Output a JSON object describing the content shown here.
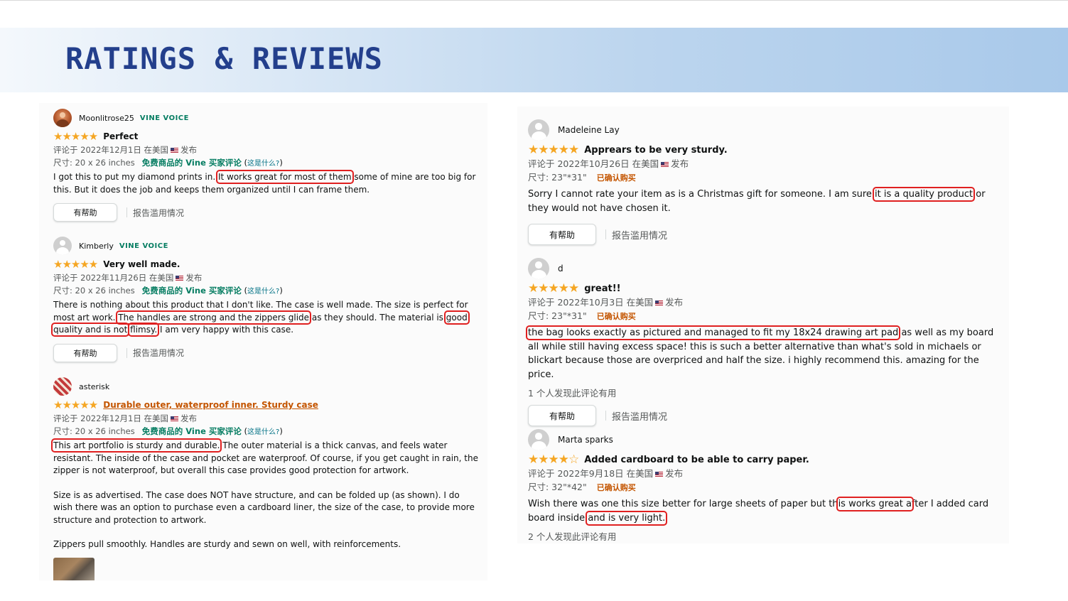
{
  "header": {
    "title": "RATINGS & REVIEWS"
  },
  "left_reviews": [
    {
      "reviewer": "Moonlitrose25",
      "badge": "VINE VOICE",
      "stars": "★★★★★",
      "rating": 5,
      "title": "Perfect",
      "date_pre": "评论于 2022年12月1日 在美国",
      "date_post": "发布",
      "size": "尺寸: 20 x 26 inches",
      "vine_label": "免费商品的 Vine 买家评论",
      "paren_open": "(",
      "whatis": "这是什么?",
      "paren_close": ")",
      "body": [
        {
          "a": "I got this to put my diamond prints in.",
          "hl1": "It works great for most of them",
          "b": "some of mine are too big for this. But it does the job and keeps them organized until I can frame them."
        }
      ],
      "helpful": "有帮助",
      "report": "报告滥用情况"
    },
    {
      "reviewer": "Kimberly",
      "badge": "VINE VOICE",
      "stars": "★★★★★",
      "rating": 5,
      "title": "Very well made.",
      "date_pre": "评论于 2022年11月26日 在美国",
      "date_post": "发布",
      "size": "尺寸: 20 x 26 inches",
      "vine_label": "免费商品的 Vine 买家评论",
      "paren_open": "(",
      "whatis": "这是什么?",
      "paren_close": ")",
      "body_a": "There is nothing about this product that I don't like. The case is well made. The size is perfect for most art work.",
      "body_hl1": "The handles are strong and the zippers glide",
      "body_b": "as they should. The material is",
      "body_hl2": "good quality and is not",
      "body_hl3": "flimsy.",
      "body_c": "I am very happy with this case.",
      "helpful": "有帮助",
      "report": "报告滥用情况"
    },
    {
      "reviewer": "asterisk",
      "stars": "★★★★★",
      "rating": 5,
      "title": "Durable outer, waterproof inner. Sturdy case",
      "date_pre": "评论于 2022年12月1日 在美国",
      "date_post": "发布",
      "size": "尺寸: 20 x 26 inches",
      "vine_label": "免费商品的 Vine 买家评论",
      "paren_open": "(",
      "whatis": "这是什么?",
      "paren_close": ")",
      "body_hl1": "This art portfolio is sturdy and durable.",
      "body_a": "The outer material is a thick canvas, and feels water resistant. The inside of the case and pocket are waterproof. Of course, if you get caught in rain, the zipper is not waterproof, but overall this case provides good protection for artwork.",
      "body_p2": "Size is as advertised. The case does NOT have structure, and can be folded up (as shown). I do wish there was an option to purchase even a cardboard liner, the size of the case, to provide more structure and protection to artwork.",
      "body_p3": "Zippers pull smoothly. Handles are sturdy and sewn on well, with reinforcements."
    }
  ],
  "right_reviews": [
    {
      "reviewer": "Madeleine Lay",
      "stars": "★★★★★",
      "rating": 5,
      "title": "Apprears to be very sturdy.",
      "date_pre": "评论于 2022年10月26日 在美国",
      "date_post": "发布",
      "size": "尺寸: 23\"*31\"",
      "verified": "已确认购买",
      "body_a": "Sorry I cannot rate your item as is a Christmas gift for someone. I am sure",
      "body_hl1": "it is a quality product",
      "body_b": "or they would not have chosen it.",
      "helpful": "有帮助",
      "report": "报告滥用情况"
    },
    {
      "reviewer": "d",
      "stars": "★★★★★",
      "rating": 5,
      "title": "great!!",
      "date_pre": "评论于 2022年10月3日 在美国",
      "date_post": "发布",
      "size": "尺寸: 23\"*31\"",
      "verified": "已确认购买",
      "body_hl1": "the bag looks exactly as pictured and managed to fit my 18x24 drawing art pad",
      "body_a": "as well as my board all while still having excess space! this is such a better alternative than what's sold in michaels or blickart because those are overpriced and half the size. i highly recommend this. amazing for the price.",
      "found": "1 个人发现此评论有用",
      "helpful": "有帮助",
      "report": "报告滥用情况"
    },
    {
      "reviewer": "Marta sparks",
      "stars": "★★★★☆",
      "rating": 4,
      "title": "Added cardboard to be able to carry paper.",
      "date_pre": "评论于 2022年9月18日 在美国",
      "date_post": "发布",
      "size": "尺寸: 32\"*42\"",
      "verified": "已确认购买",
      "body_a": "Wish there was one this size better for large sheets of paper but th",
      "body_hl1": "is works great a",
      "body_b": "fter I added card board inside",
      "body_hl2": "and is very light.",
      "found": "2 个人发现此评论有用"
    }
  ],
  "colors": {
    "title": "#233f8c",
    "highlight": "#e02020",
    "vine": "#067d62",
    "star": "#f5a623",
    "verified": "#c45500"
  }
}
